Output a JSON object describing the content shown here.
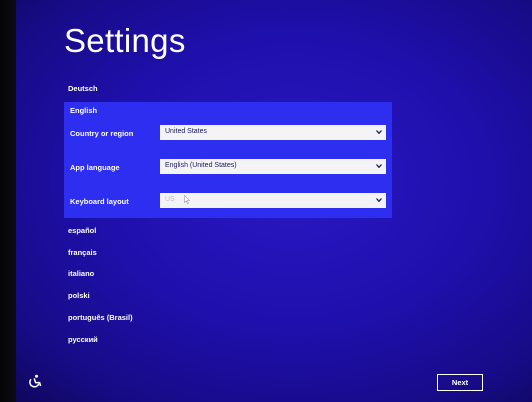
{
  "title": "Settings",
  "languages_above": [
    "Deutsch"
  ],
  "selected_language": "English",
  "fields": [
    {
      "label": "Country or region",
      "value": "United States"
    },
    {
      "label": "App language",
      "value": "English (United States)"
    },
    {
      "label": "Keyboard layout",
      "value": "US"
    }
  ],
  "languages_below": [
    "español",
    "français",
    "italiano",
    "polski",
    "português (Brasil)",
    "русский"
  ],
  "next_button": "Next",
  "icons": {
    "ease_of_access": "ease-of-access-icon",
    "dropdown": "chevron-down-icon",
    "cursor": "mouse-cursor-icon"
  },
  "colors": {
    "background": "#1f10ad",
    "panel": "#2d2ef0",
    "field_bg": "#f4f4f6",
    "text": "#ffffff"
  }
}
